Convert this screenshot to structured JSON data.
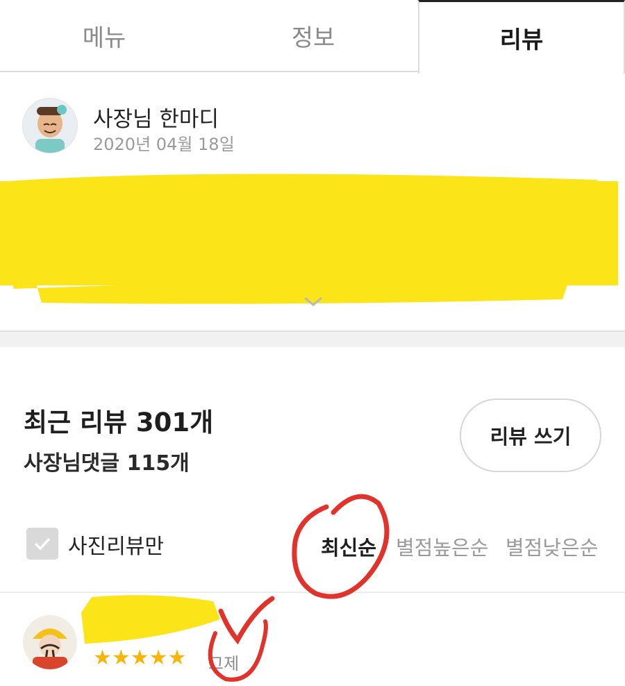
{
  "tabs": [
    {
      "label": "메뉴"
    },
    {
      "label": "정보"
    },
    {
      "label": "리뷰",
      "active": true
    }
  ],
  "owner_notice": {
    "title": "사장님 한마디",
    "date": "2020년 04월 18일",
    "icon": "chevron-down-icon",
    "redaction_color": "#fbe418"
  },
  "summary": {
    "title": "최근 리뷰 301개",
    "subtitle": "사장님댓글 115개",
    "write_button": "리뷰 쓰기"
  },
  "filters": {
    "photo_only": "사진리뷰만",
    "photo_only_checked": false,
    "sort_options": [
      "최신순",
      "별점높은순",
      "별점낮은순"
    ],
    "selected_sort": "최신순"
  },
  "review": {
    "stars": "★★★★★",
    "rating": 5,
    "date": "그제"
  },
  "colors": {
    "accent_text": "#1e1e1e",
    "muted_text": "#9a9a9a",
    "star": "#f5b50a",
    "annotation_red": "#e0332b"
  }
}
